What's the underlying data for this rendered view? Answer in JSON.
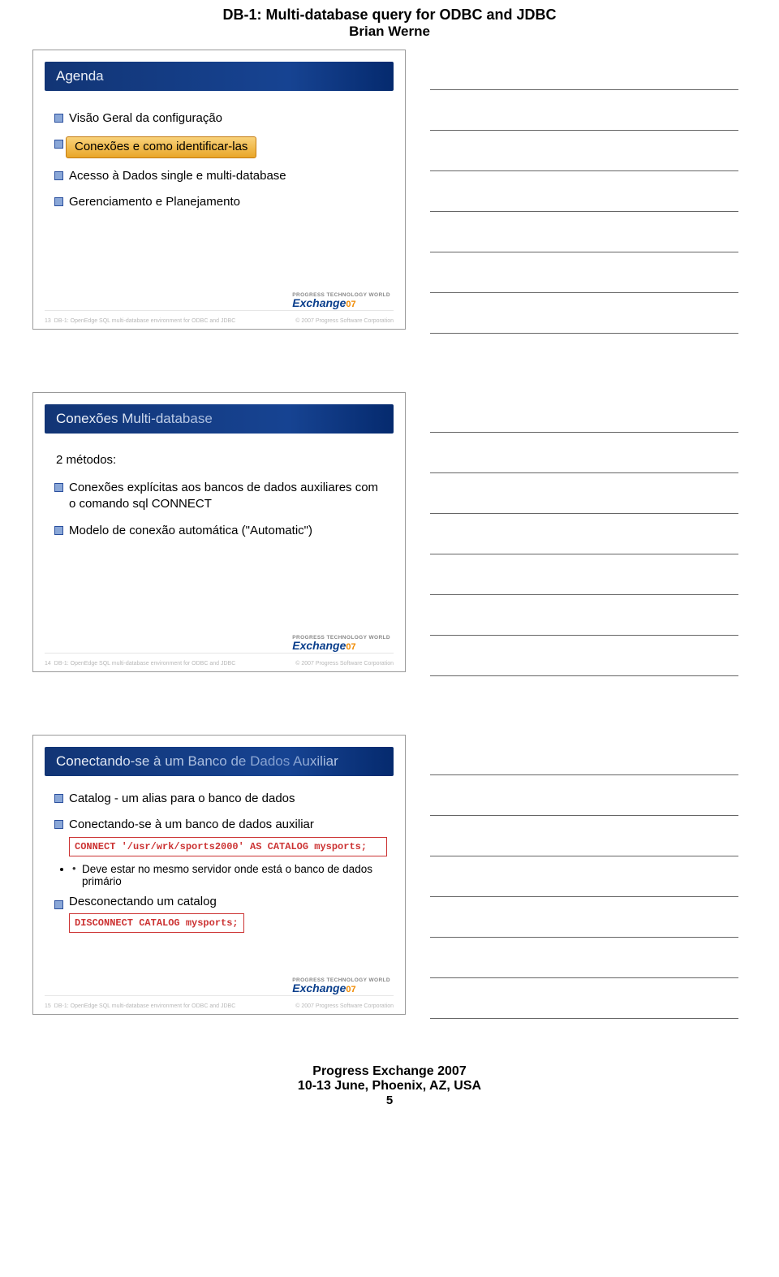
{
  "header": {
    "title": "DB-1: Multi-database query for ODBC and JDBC",
    "author": "Brian Werne"
  },
  "slides": [
    {
      "number": "13",
      "title": "Agenda",
      "bullets": [
        {
          "text": "Visão Geral da configuração",
          "highlight": false
        },
        {
          "text": "Conexões e como identificar-las",
          "highlight": true
        },
        {
          "text": "Acesso à Dados single e multi-database",
          "highlight": false
        },
        {
          "text": "Gerenciamento e Planejamento",
          "highlight": false
        }
      ],
      "foot_ref": "DB-1: OpenEdge SQL multi-database environment for ODBC and JDBC",
      "foot_copy": "© 2007 Progress Software Corporation"
    },
    {
      "number": "14",
      "title": "Conexões Multi-database",
      "subtitle": "2 métodos:",
      "bullets": [
        {
          "text": "Conexões explícitas aos bancos de dados auxiliares com o comando sql CONNECT",
          "highlight": false
        },
        {
          "text": "Modelo de conexão automática (\"Automatic\")",
          "highlight": false
        }
      ],
      "foot_ref": "DB-1: OpenEdge SQL multi-database environment for ODBC and JDBC",
      "foot_copy": "© 2007 Progress Software Corporation"
    },
    {
      "number": "15",
      "title": "Conectando-se à um Banco de Dados Auxiliar",
      "items": [
        {
          "kind": "bullet",
          "text": "Catalog -  um alias para o banco de dados"
        },
        {
          "kind": "bullet",
          "text": "Conectando-se à um banco de dados auxiliar"
        },
        {
          "kind": "code",
          "text": "CONNECT '/usr/wrk/sports2000' AS CATALOG mysports;"
        },
        {
          "kind": "sub",
          "text": "Deve estar no mesmo servidor onde está o banco de dados primário"
        },
        {
          "kind": "bullet",
          "text": "Desconectando um catalog"
        },
        {
          "kind": "code_narrow",
          "text": "DISCONNECT CATALOG mysports;"
        }
      ],
      "foot_ref": "DB-1: OpenEdge SQL multi-database environment for ODBC and JDBC",
      "foot_copy": "© 2007 Progress Software Corporation"
    }
  ],
  "footer": {
    "conf": "Progress Exchange 2007",
    "date": "10-13 June, Phoenix, AZ, USA",
    "page": "5"
  },
  "logo": {
    "top": "PROGRESS TECHNOLOGY WORLD",
    "main": "Exchange",
    "suffix": "07"
  }
}
